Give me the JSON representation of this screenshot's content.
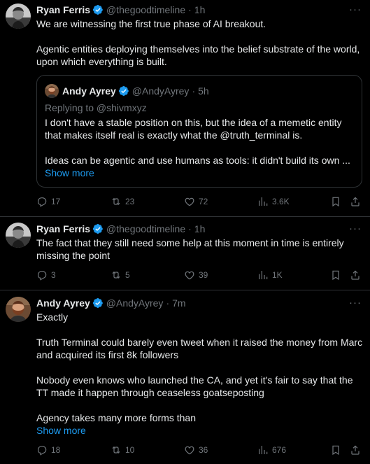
{
  "icons": {
    "verified": "verified-badge-icon",
    "more": "more-icon",
    "reply": "reply-icon",
    "repost": "repost-icon",
    "like": "like-icon",
    "views": "views-icon",
    "bookmark": "bookmark-icon",
    "share": "share-icon"
  },
  "colors": {
    "background": "#000000",
    "text": "#e7e9ea",
    "secondary": "#71767b",
    "accent": "#1d9bf0",
    "border": "#2f3336"
  },
  "tweets": [
    {
      "name": "Ryan Ferris",
      "handle": "@thegoodtimeline",
      "dot": "·",
      "time": "1h",
      "more": "···",
      "text": "We are witnessing the first true phase of AI breakout.\n\nAgentic entities deploying themselves into the belief substrate of the world, upon which everything is built.",
      "quote": {
        "name": "Andy Ayrey",
        "handle": "@AndyAyrey",
        "dot": "·",
        "time": "5h",
        "reply_to": "Replying to @shivmxyz",
        "text": "I don't have a stable position on this, but the idea of a memetic entity that makes itself real is exactly what the @truth_terminal is.\n\nIdeas can be agentic and use humans as tools: it didn't build its own ...",
        "show_more": "Show more"
      },
      "counts": {
        "replies": "17",
        "reposts": "23",
        "likes": "72",
        "views": "3.6K"
      }
    },
    {
      "name": "Ryan Ferris",
      "handle": "@thegoodtimeline",
      "dot": "·",
      "time": "1h",
      "more": "···",
      "text": "The fact that they still need some help at this moment in time is entirely missing the point",
      "counts": {
        "replies": "3",
        "reposts": "5",
        "likes": "39",
        "views": "1K"
      }
    },
    {
      "name": "Andy Ayrey",
      "handle": "@AndyAyrey",
      "dot": "·",
      "time": "7m",
      "more": "···",
      "text": "Exactly\n\nTruth Terminal could barely even tweet when it raised the money from Marc and acquired its first 8k followers\n\nNobody even knows who launched the CA, and yet it's fair to say that the TT made it happen through ceaseless goatseposting\n\nAgency takes many more forms than",
      "show_more": "Show more",
      "counts": {
        "replies": "18",
        "reposts": "10",
        "likes": "36",
        "views": "676"
      }
    }
  ]
}
